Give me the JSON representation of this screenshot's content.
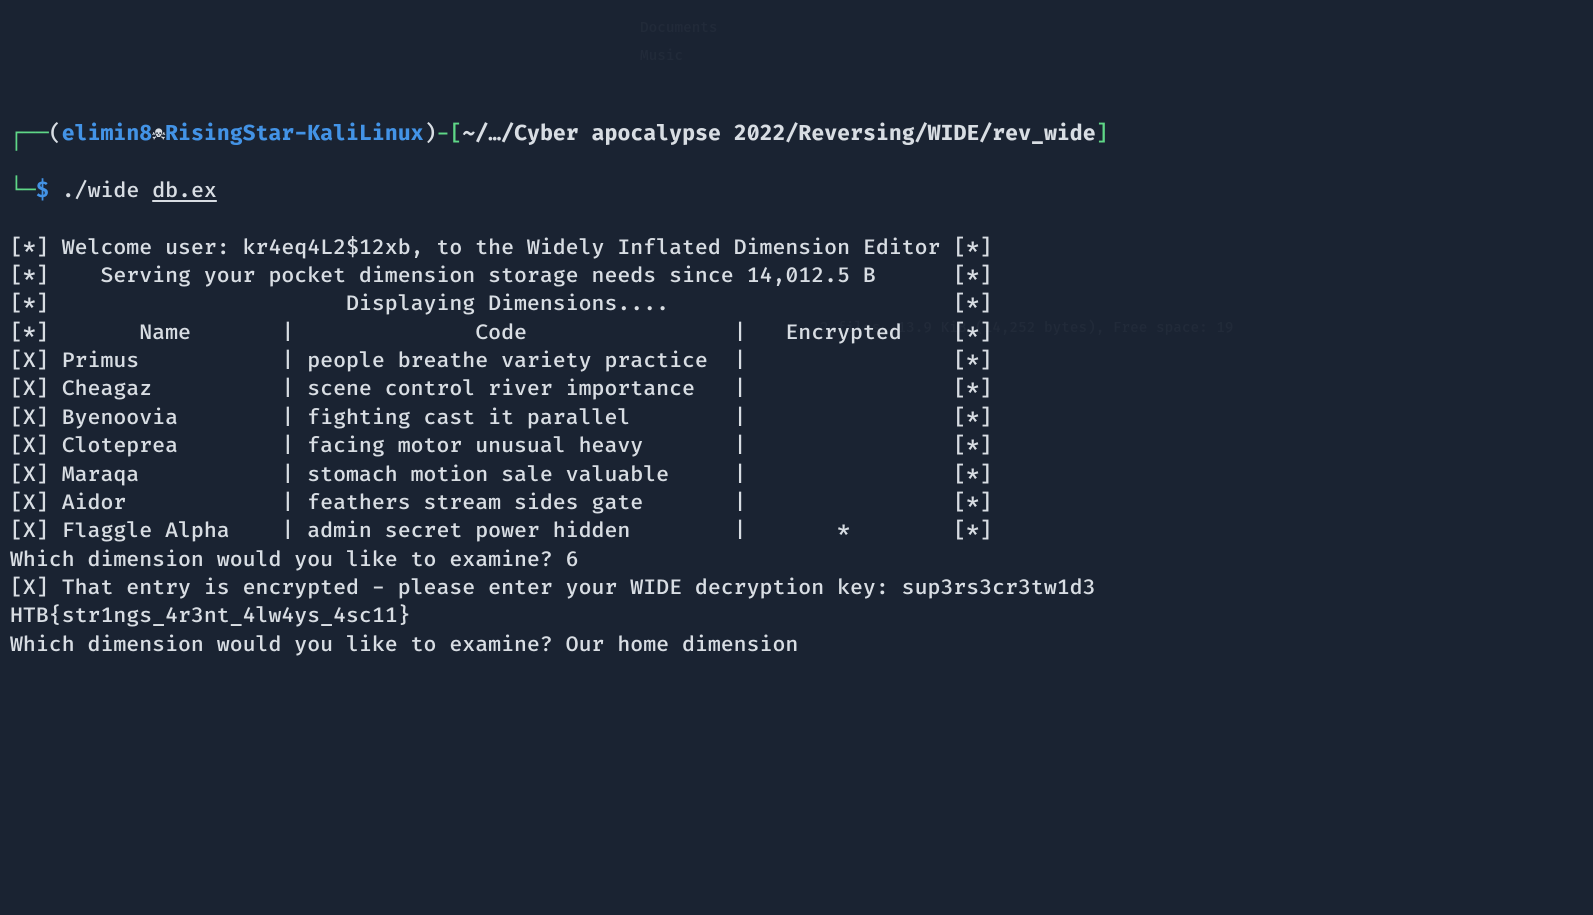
{
  "prompt": {
    "corner_top": "┌──",
    "paren_open": "(",
    "user": "elimin8",
    "skull": "☠",
    "host": "RisingStar-KaliLinux",
    "paren_close": ")",
    "dash": "-",
    "bracket_open": "[",
    "path": "~/…/Cyber apocalypse 2022/Reversing/WIDE/rev_wide",
    "bracket_close": "]",
    "corner_bottom": "└─",
    "dollar": "$",
    "command": "./wide",
    "argument": "db.ex"
  },
  "output": {
    "line1": "[*] Welcome user: kr4eq4L2$12xb, to the Widely Inflated Dimension Editor [*]",
    "line2": "[*]    Serving your pocket dimension storage needs since 14,012.5 B      [*]",
    "line3": "[*]                       Displaying Dimensions....                      [*]",
    "line4": "[*]       Name       |              Code                |   Encrypted    [*]",
    "row0": "[X] Primus           | people breathe variety practice  |                [*]",
    "row1": "[X] Cheagaz          | scene control river importance   |                [*]",
    "row2": "[X] Byenoovia        | fighting cast it parallel        |                [*]",
    "row3": "[X] Cloteprea        | facing motor unusual heavy       |                [*]",
    "row4": "[X] Maraqa           | stomach motion sale valuable     |                [*]",
    "row5": "[X] Aidor            | feathers stream sides gate       |                [*]",
    "row6": "[X] Flaggle Alpha    | admin secret power hidden        |       *        [*]",
    "prompt1": "Which dimension would you like to examine? 6",
    "encrypted": "[X] That entry is encrypted - please enter your WIDE decryption key: sup3rs3cr3tw1d3",
    "flag": "HTB{str1ngs_4r3nt_4lw4ys_4sc11}",
    "prompt2": "Which dimension would you like to examine? Our home dimension"
  },
  "ghost": {
    "g1": "Documents",
    "g2": "Music",
    "g3": "2 files, 13.9 KiB (14,252 bytes), Free space: 19"
  }
}
